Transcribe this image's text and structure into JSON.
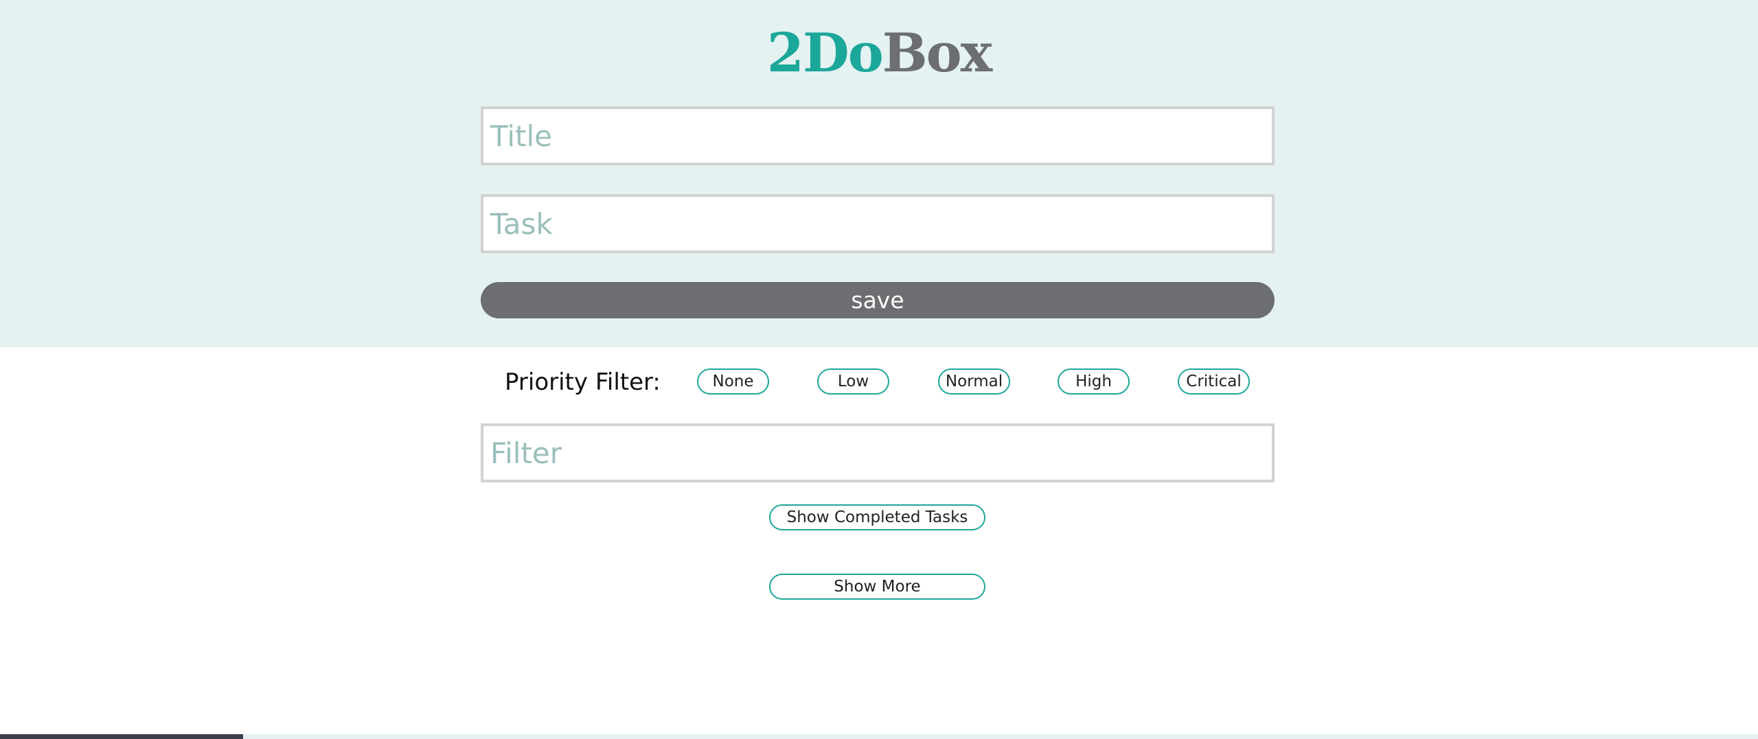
{
  "header": {
    "logo_part_a": "2Do",
    "logo_part_b": "Box"
  },
  "form": {
    "title_placeholder": "Title",
    "task_placeholder": "Task",
    "save_label": "save"
  },
  "priority_filter": {
    "label": "Priority Filter:",
    "options": [
      "None",
      "Low",
      "Normal",
      "High",
      "Critical"
    ]
  },
  "filter": {
    "placeholder": "Filter"
  },
  "actions": {
    "show_completed_label": "Show Completed Tasks",
    "show_more_label": "Show More"
  },
  "colors": {
    "accent": "#1ba79a",
    "dark_gray": "#6d6e71",
    "header_bg": "#e5f2f2",
    "placeholder": "#9bbfbb"
  }
}
